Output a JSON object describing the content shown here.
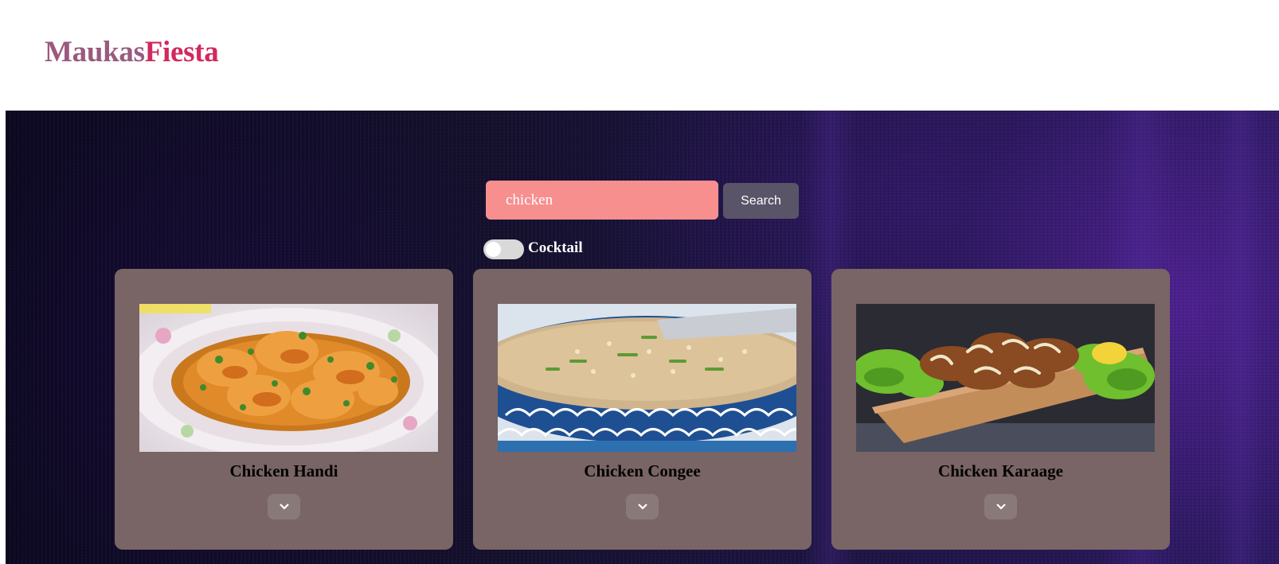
{
  "header": {
    "logo_part1": "Maukas",
    "logo_part2": "Fiesta"
  },
  "search": {
    "value": "chicken",
    "button_label": "Search"
  },
  "filter": {
    "toggle_label": "Cocktail",
    "toggle_on": false
  },
  "results": [
    {
      "title": "Chicken Handi",
      "expand_icon": "chevron-down-icon"
    },
    {
      "title": "Chicken Congee",
      "expand_icon": "chevron-down-icon"
    },
    {
      "title": "Chicken Karaage",
      "expand_icon": "chevron-down-icon"
    }
  ],
  "colors": {
    "logo_part1": "#9a5a7e",
    "logo_part2": "#d2295c",
    "search_input_bg": "#f78f8f",
    "search_button_bg": "#5a5468",
    "card_bg": "#796565"
  }
}
